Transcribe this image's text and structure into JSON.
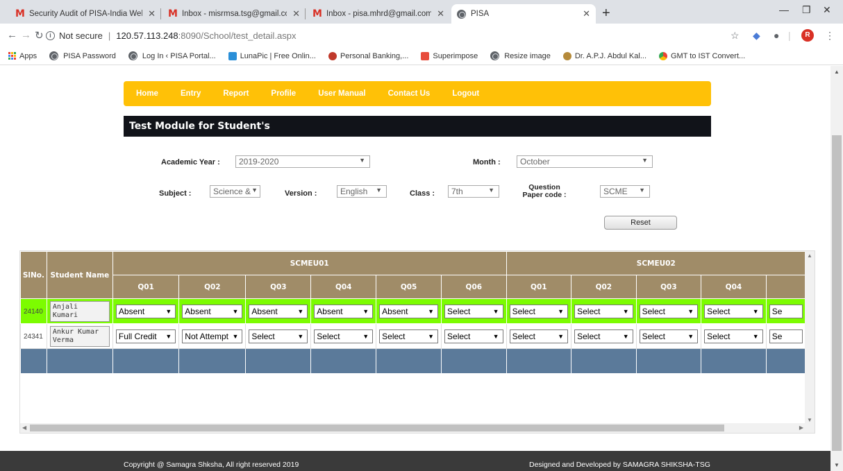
{
  "browser": {
    "tabs": [
      {
        "title": "Security Audit of PISA-India Web",
        "icon": "gmail-icon"
      },
      {
        "title": "Inbox - misrmsa.tsg@gmail.com",
        "icon": "gmail-icon"
      },
      {
        "title": "Inbox - pisa.mhrd@gmail.com -",
        "icon": "gmail-icon"
      },
      {
        "title": "PISA",
        "icon": "globe-icon",
        "active": true
      }
    ],
    "address": {
      "security": "Not secure",
      "host": "120.57.113.248",
      "path": ":8090/School/test_detail.aspx"
    },
    "profile_initial": "R",
    "bookmarks": [
      {
        "label": "Apps",
        "icon": "apps-icon"
      },
      {
        "label": "PISA Password",
        "icon": "globe-icon"
      },
      {
        "label": "Log In ‹ PISA Portal...",
        "icon": "globe-icon"
      },
      {
        "label": "LunaPic | Free Onlin...",
        "icon": "lunapic-icon"
      },
      {
        "label": "Personal Banking,...",
        "icon": "bank-icon"
      },
      {
        "label": "Superimpose",
        "icon": "superimpose-icon"
      },
      {
        "label": "Resize image",
        "icon": "globe-icon"
      },
      {
        "label": "Dr. A.P.J. Abdul Kal...",
        "icon": "kalam-icon"
      },
      {
        "label": "GMT to IST Convert...",
        "icon": "chrome-icon"
      }
    ]
  },
  "nav": [
    "Home",
    "Entry",
    "Report",
    "Profile",
    "User Manual",
    "Contact Us",
    "Logout"
  ],
  "module_title": "Test Module for Student's",
  "filters": {
    "academic_year_label": "Academic Year :",
    "academic_year": "2019-2020",
    "month_label": "Month :",
    "month": "October",
    "subject_label": "Subject :",
    "subject": "Science &",
    "version_label": "Version :",
    "version": "English",
    "class_label": "Class :",
    "class": "7th",
    "qp_label": "Question Paper code :",
    "qp": "SCME",
    "reset_label": "Reset"
  },
  "grid": {
    "slno_header": "SlNo.",
    "name_header": "Student Name",
    "groups": [
      {
        "name": "SCMEU01",
        "questions": [
          "Q01",
          "Q02",
          "Q03",
          "Q04",
          "Q05",
          "Q06"
        ]
      },
      {
        "name": "SCMEU02",
        "questions": [
          "Q01",
          "Q02",
          "Q03",
          "Q04"
        ]
      }
    ],
    "rows": [
      {
        "slno": "24140",
        "name": "Anjali Kumari",
        "status": "absent",
        "answers": [
          "Absent",
          "Absent",
          "Absent",
          "Absent",
          "Absent",
          "Select",
          "Select",
          "Select",
          "Select",
          "Select",
          "Se"
        ]
      },
      {
        "slno": "24341",
        "name": "Ankur Kumar Verma",
        "status": "normal",
        "answers": [
          "Full Credit",
          "Not Attempt",
          "Select",
          "Select",
          "Select",
          "Select",
          "Select",
          "Select",
          "Select",
          "Select",
          "Se"
        ]
      }
    ]
  },
  "footer": {
    "copyright": "Copyright @ Samagra Shksha, All right reserved 2019",
    "designed": "Designed and Developed by SAMAGRA SHIKSHA-TSG"
  },
  "colors": {
    "nav_bg": "#ffc107",
    "header_bg": "#111319",
    "grid_header": "#a08c68",
    "absent_row": "#7cfc00",
    "grid_footer": "#5b7a9a",
    "footer_bg": "#3a3a3a"
  }
}
